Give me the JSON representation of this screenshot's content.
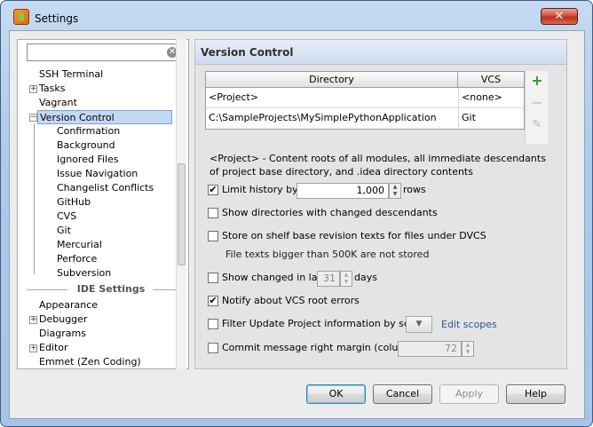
{
  "window": {
    "title": "Settings",
    "close_glyph": "✕"
  },
  "search": {
    "value": "",
    "placeholder": "",
    "clear_icon": "✕"
  },
  "tree": {
    "items": [
      {
        "label": "SSH Terminal"
      },
      {
        "label": "Tasks"
      },
      {
        "label": "Vagrant"
      },
      {
        "label": "Version Control"
      },
      {
        "label": "Confirmation"
      },
      {
        "label": "Background"
      },
      {
        "label": "Ignored Files"
      },
      {
        "label": "Issue Navigation"
      },
      {
        "label": "Changelist Conflicts"
      },
      {
        "label": "GitHub"
      },
      {
        "label": "CVS"
      },
      {
        "label": "Git"
      },
      {
        "label": "Mercurial"
      },
      {
        "label": "Perforce"
      },
      {
        "label": "Subversion"
      }
    ],
    "ide_header": "IDE Settings",
    "ide_items": [
      {
        "label": "Appearance"
      },
      {
        "label": "Debugger"
      },
      {
        "label": "Diagrams"
      },
      {
        "label": "Editor"
      },
      {
        "label": "Emmet (Zen Coding)"
      }
    ],
    "plus": "+",
    "minus": "−"
  },
  "panel": {
    "title": "Version Control",
    "table": {
      "headers": [
        "Directory",
        "VCS"
      ],
      "rows": [
        [
          "<Project>",
          "<none>"
        ],
        [
          "C:\\SampleProjects\\MySimplePythonApplication",
          "Git"
        ]
      ],
      "actions": {
        "add": "+",
        "remove": "−",
        "edit": "✎"
      }
    },
    "description": "<Project> - Content roots of all modules, all immediate descendants of project base directory, and .idea directory contents",
    "limit_history": {
      "label": "Limit history by:",
      "checked": true,
      "value": "1,000",
      "unit": "rows"
    },
    "show_dirs": {
      "label": "Show directories with changed descendants",
      "checked": false
    },
    "store_shelf": {
      "label": "Store on shelf base revision texts for files under DVCS",
      "checked": false,
      "note": "File texts bigger than 500K are not stored"
    },
    "show_changed": {
      "label": "Show changed in last",
      "checked": false,
      "value": "31",
      "unit": "days"
    },
    "notify": {
      "label": "Notify about VCS root errors",
      "checked": true
    },
    "filter_update": {
      "label": "Filter Update Project information by scope",
      "checked": false,
      "edit_scopes": "Edit scopes"
    },
    "commit_margin": {
      "label": "Commit message right margin (columns):",
      "checked": false,
      "value": "72"
    },
    "check_glyph": "✔",
    "arrow_up": "▲",
    "arrow_down": "▼"
  },
  "buttons": {
    "ok": "OK",
    "cancel": "Cancel",
    "apply": "Apply",
    "help": "Help"
  }
}
